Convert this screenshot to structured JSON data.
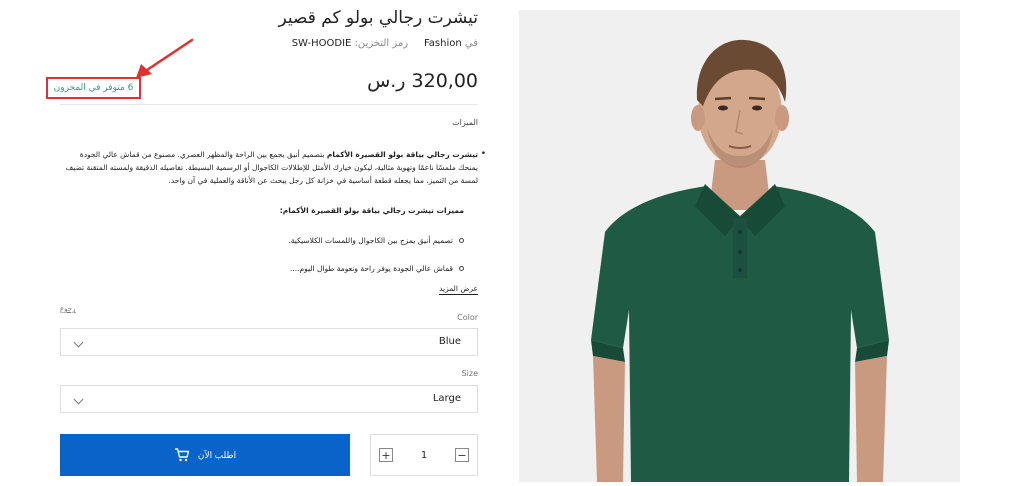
{
  "product": {
    "title": "تيشرت رجالي بولو كم قصير",
    "brand_prefix": "في",
    "brand": "Fashion",
    "sku_label": "رمز التخزين:",
    "sku": "SW-HOODIE",
    "price": "320,00 ر.س"
  },
  "stock": {
    "text": "6 متوفر في المخزون"
  },
  "description": {
    "features_heading": "الميزات",
    "paragraph_bold": "تيشرت رجالي بياقة بولو القصيرة الأكمام",
    "paragraph_rest": " بتصميم أنيق يجمع بين الراحة والمظهر العصري. مصنوع من قماش عالي الجودة يمنحك ملمسًا ناعمًا وتهوية مثالية، ليكون خيارك الأمثل للإطلالات الكاجوال أو الرسمية البسيطة. تفاصيله الدقيقة ولمسته المتقنة تضيف لمسة من التميز، مما يجعله قطعة أساسية في خزانة كل رجل يبحث عن الأناقة والعملية في آن واحد.",
    "subheading": "مميزات تيشرت رجالي بياقة بولو القصيرة الأكمام:",
    "items": [
      "تصميم أنيق يمزج بين الكاجوال واللمسات الكلاسيكية.",
      "قماش عالي الجودة يوفر راحة ونعومة طوال اليوم...."
    ],
    "show_more": "عرض المزيد"
  },
  "variations": {
    "reset": "رجوع",
    "color_label": "Color",
    "color_value": "Blue",
    "size_label": "Size",
    "size_value": "Large"
  },
  "cart": {
    "buy_label": "اطلب الآن",
    "quantity": "1",
    "plus": "+",
    "minus": "−"
  },
  "colors": {
    "accent": "#0a63c8",
    "stock_green": "#2aa08a",
    "highlight_red": "#e0302f",
    "shirt_green": "#1f5a44"
  }
}
